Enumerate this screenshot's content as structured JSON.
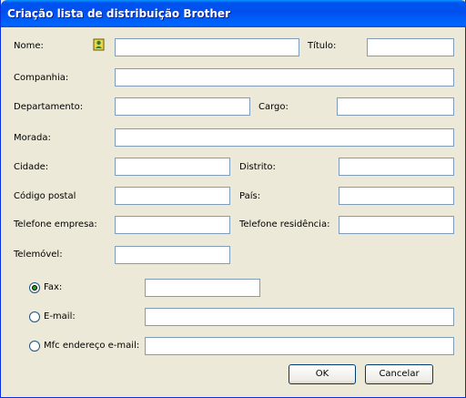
{
  "window": {
    "title": "Criação lista de distribuição Brother"
  },
  "labels": {
    "nome": "Nome:",
    "titulo": "Título:",
    "companhia": "Companhia:",
    "departamento": "Departamento:",
    "cargo": "Cargo:",
    "morada": "Morada:",
    "cidade": "Cidade:",
    "distrito": "Distrito:",
    "codigo_postal": "Código postal",
    "pais": "País:",
    "telefone_empresa": "Telefone empresa:",
    "telefone_residencia": "Telefone residência:",
    "telemovel": "Telemóvel:"
  },
  "fields": {
    "nome": "",
    "titulo": "",
    "companhia": "",
    "departamento": "",
    "cargo": "",
    "morada": "",
    "cidade": "",
    "distrito": "",
    "codigo_postal": "",
    "pais": "",
    "telefone_empresa": "",
    "telefone_residencia": "",
    "telemovel": "",
    "fax": "",
    "email": "",
    "mfc_email": ""
  },
  "delivery": {
    "selected": "fax",
    "options": [
      {
        "id": "fax",
        "label": "Fax:"
      },
      {
        "id": "email",
        "label": "E-mail:"
      },
      {
        "id": "mfc_email",
        "label": "Mfc endereço e-mail:"
      }
    ]
  },
  "buttons": {
    "ok": "OK",
    "cancel": "Cancelar"
  },
  "icons": {
    "contact": "address-card-icon"
  }
}
